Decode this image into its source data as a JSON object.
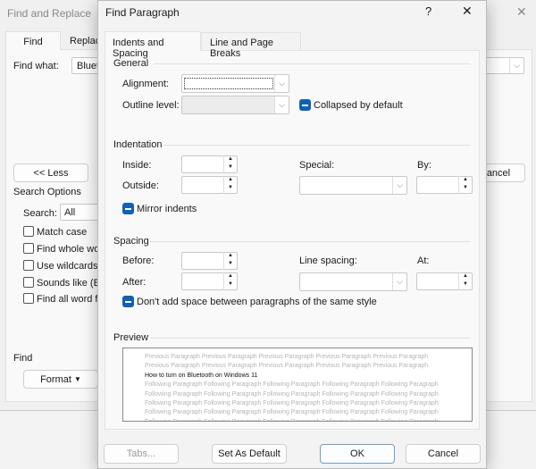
{
  "background": {
    "title": "Find and Replace",
    "tabs": [
      "Find",
      "Replace"
    ],
    "find_what_label": "Find what:",
    "find_what_value": "Bluetooth",
    "less_button": "<< Less",
    "cancel_button": "Cancel",
    "search_options": "Search Options",
    "search_label": "Search:",
    "search_value": "All",
    "checkboxes": [
      "Match case",
      "Find whole words only",
      "Use wildcards",
      "Sounds like (English)",
      "Find all word forms (English)"
    ],
    "find_section": "Find",
    "format_button": "Format"
  },
  "dialog": {
    "title": "Find Paragraph",
    "help": "?",
    "close": "✕",
    "tabs": [
      "Indents and Spacing",
      "Line and Page Breaks"
    ],
    "general": {
      "heading": "General",
      "alignment_label": "Alignment:",
      "alignment_value": "",
      "outline_label": "Outline level:",
      "outline_value": "",
      "collapsed_label": "Collapsed by default"
    },
    "indentation": {
      "heading": "Indentation",
      "inside_label": "Inside:",
      "outside_label": "Outside:",
      "special_label": "Special:",
      "by_label": "By:",
      "mirror_label": "Mirror indents"
    },
    "spacing": {
      "heading": "Spacing",
      "before_label": "Before:",
      "after_label": "After:",
      "line_spacing_label": "Line spacing:",
      "at_label": "At:",
      "dont_add_label": "Don't add space between paragraphs of the same style"
    },
    "preview": {
      "heading": "Preview",
      "previous": "Previous Paragraph Previous Paragraph Previous Paragraph Previous Paragraph Previous Paragraph",
      "current": "How to turn on Bluetooth on Windows 11",
      "following": "Following Paragraph Following Paragraph Following Paragraph Following Paragraph Following Paragraph"
    },
    "buttons": {
      "tabs": "Tabs...",
      "set_default": "Set As Default",
      "ok": "OK",
      "cancel": "Cancel"
    }
  }
}
